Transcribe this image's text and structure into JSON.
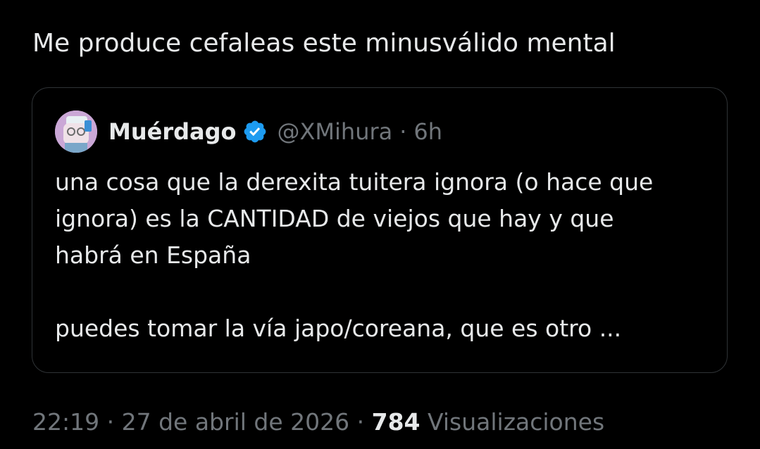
{
  "post": {
    "text": "Me produce cefaleas este minusválido mental"
  },
  "quoted": {
    "author_name": "Muérdago",
    "handle": "@XMihura",
    "separator": "·",
    "age": "6h",
    "body_line_1": "una cosa que la derexita tuitera ignora (o hace que",
    "body_line_2": "ignora) es la CANTIDAD de viejos que hay y que",
    "body_line_3": "habrá en España",
    "body_line_4": "puedes tomar la vía japo/coreana, que es otro ...",
    "verified_color": "#1d9bf0",
    "avatar_color": "#caa7d6"
  },
  "meta": {
    "time": "22:19",
    "sep1": "·",
    "date": "27 de abril de 2026",
    "sep2": "·",
    "views_count": "784",
    "views_label": "Visualizaciones"
  }
}
